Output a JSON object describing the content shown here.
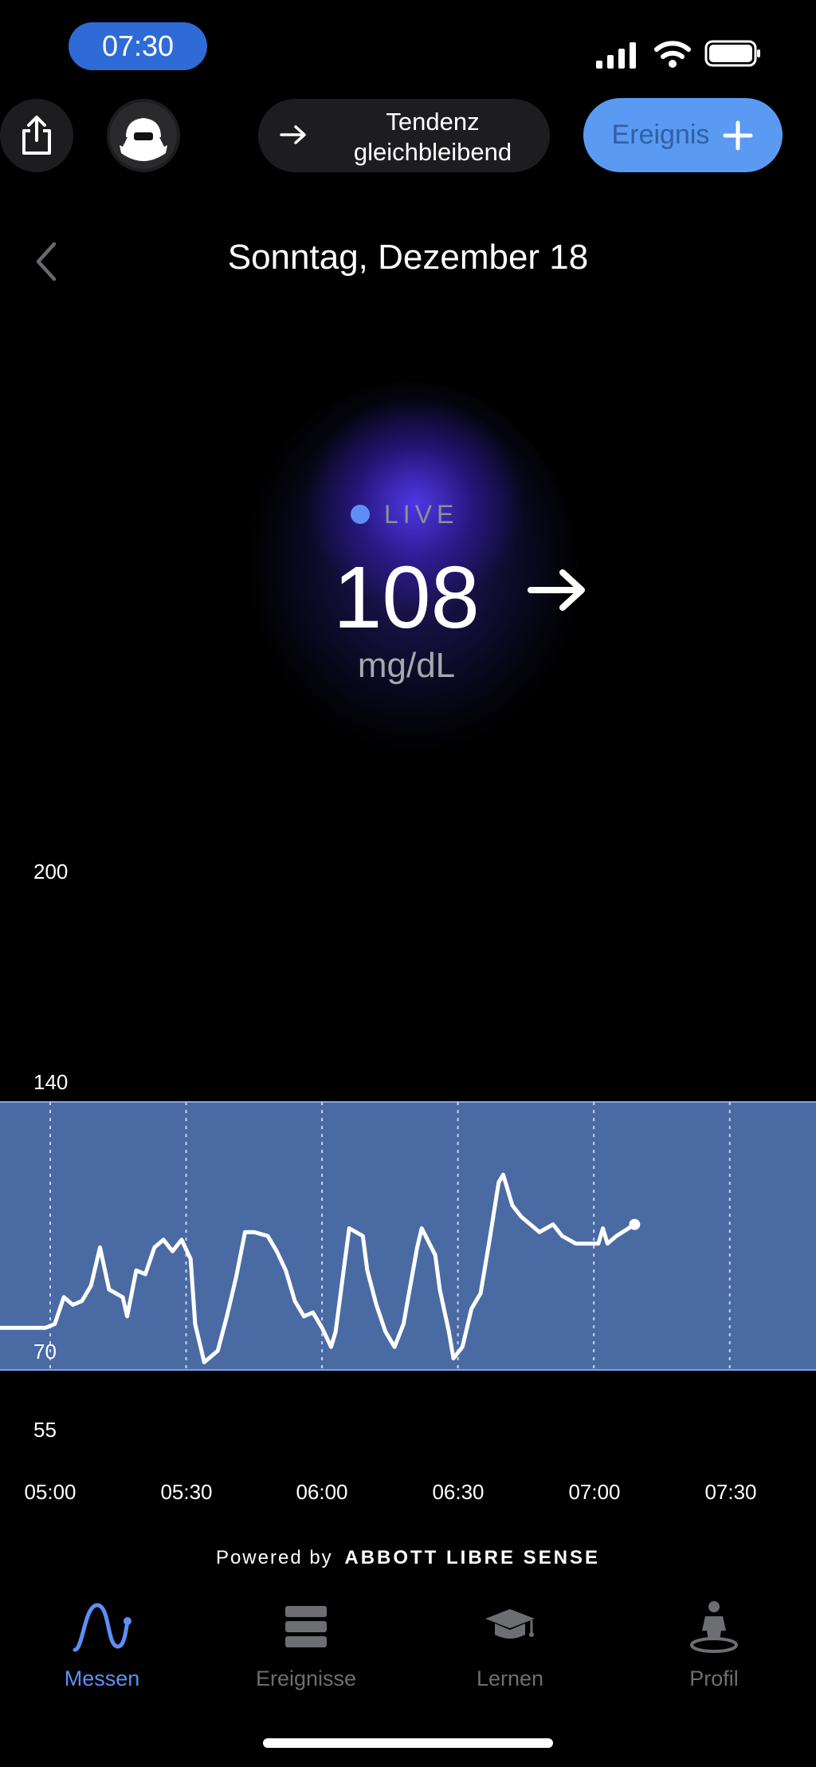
{
  "status_bar": {
    "time": "07:30"
  },
  "header": {
    "trend_label": "Tendenz gleichbleibend",
    "event_button_label": "Ereignis",
    "event_button_icon": "plus-icon",
    "share_icon": "share-icon",
    "avatar_icon": "avatar-icon"
  },
  "date_title": "Sonntag, Dezember 18",
  "live": {
    "label": "LIVE",
    "value": "108",
    "unit": "mg/dL",
    "trend_icon": "arrow-right-icon"
  },
  "chart_data": {
    "type": "line",
    "title": "",
    "xlabel": "",
    "ylabel": "",
    "x_ticks": [
      "05:00",
      "05:30",
      "06:00",
      "06:30",
      "07:00",
      "07:30"
    ],
    "y_ticks": [
      200,
      140,
      70,
      55
    ],
    "target_range": [
      70,
      140
    ],
    "x_range_minutes": [
      -11,
      97
    ],
    "series": [
      {
        "values": [
          [
            -11,
            81
          ],
          [
            -1,
            81
          ],
          [
            1,
            82
          ],
          [
            3,
            89
          ],
          [
            5,
            87
          ],
          [
            7,
            88
          ],
          [
            9,
            92
          ],
          [
            11,
            102
          ],
          [
            13,
            91
          ],
          [
            16,
            89
          ],
          [
            17,
            84
          ],
          [
            19,
            96
          ],
          [
            21,
            95
          ],
          [
            23,
            102
          ],
          [
            25,
            104
          ],
          [
            27,
            101
          ],
          [
            29,
            104
          ],
          [
            31,
            99
          ],
          [
            32,
            82
          ],
          [
            34,
            72
          ],
          [
            37,
            75
          ],
          [
            39,
            84
          ],
          [
            41,
            94
          ],
          [
            43,
            106
          ],
          [
            45,
            106
          ],
          [
            48,
            105
          ],
          [
            50,
            101
          ],
          [
            52,
            96
          ],
          [
            54,
            88
          ],
          [
            56,
            84
          ],
          [
            58,
            85
          ],
          [
            60,
            81
          ],
          [
            62,
            76
          ],
          [
            63,
            80
          ],
          [
            65,
            98
          ],
          [
            66,
            107
          ],
          [
            69,
            105
          ],
          [
            70,
            96
          ],
          [
            72,
            87
          ],
          [
            74,
            80
          ],
          [
            76,
            76
          ],
          [
            78,
            82
          ],
          [
            81,
            102
          ],
          [
            82,
            107
          ],
          [
            85,
            100
          ],
          [
            86,
            91
          ],
          [
            88,
            80
          ],
          [
            89,
            73
          ],
          [
            91,
            76
          ],
          [
            93,
            86
          ],
          [
            95,
            90
          ],
          [
            97,
            104
          ],
          [
            99,
            119
          ],
          [
            100,
            121
          ],
          [
            102,
            113
          ],
          [
            104,
            110
          ],
          [
            106,
            108
          ],
          [
            108,
            106
          ],
          [
            111,
            108
          ],
          [
            113,
            105
          ],
          [
            116,
            103
          ],
          [
            121,
            103
          ],
          [
            122,
            107
          ],
          [
            123,
            103
          ],
          [
            125,
            105
          ],
          [
            129,
            108
          ]
        ]
      }
    ]
  },
  "axis": {
    "y200": "200",
    "y140": "140",
    "y70": "70",
    "y55": "55",
    "x0": "05:00",
    "x1": "05:30",
    "x2": "06:00",
    "x3": "06:30",
    "x4": "07:00",
    "x5": "07:30"
  },
  "footer": {
    "powered_prefix": "Powered by",
    "powered_brand": "ABBOTT LIBRE SENSE"
  },
  "tabs": [
    {
      "label": "Messen",
      "icon": "sensor-wave-icon",
      "active": true
    },
    {
      "label": "Ereignisse",
      "icon": "list-icon",
      "active": false
    },
    {
      "label": "Lernen",
      "icon": "graduation-cap-icon",
      "active": false
    },
    {
      "label": "Profil",
      "icon": "person-icon",
      "active": false
    }
  ],
  "colors": {
    "accent": "#5f8ff5",
    "target_band": "#4a6aa3",
    "event_button": "#5b9af2",
    "time_pill": "#2e6bd6"
  }
}
